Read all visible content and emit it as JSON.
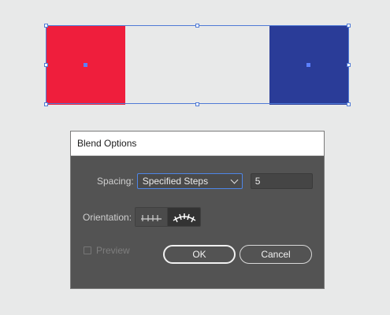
{
  "artwork": {
    "left_color": "#ef1e3c",
    "right_color": "#2a3c98",
    "selection_color": "#4f7ad6"
  },
  "dialog": {
    "title": "Blend Options",
    "spacing": {
      "label": "Spacing:",
      "selected_option": "Specified Steps",
      "steps_value": "5"
    },
    "orientation": {
      "label": "Orientation:",
      "options": [
        "align-to-page-icon",
        "align-to-path-icon"
      ],
      "selected": "align-to-path-icon"
    },
    "preview": {
      "label": "Preview",
      "checked": false
    },
    "ok_label": "OK",
    "cancel_label": "Cancel"
  }
}
